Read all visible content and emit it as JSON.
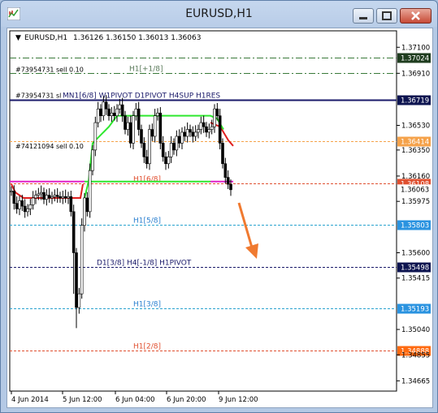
{
  "window": {
    "title": "EURUSD,H1"
  },
  "header": {
    "marker": "▼",
    "symbol": "EURUSD,H1",
    "quote": "1.36126 1.36150 1.36013 1.36063"
  },
  "chart_data": {
    "type": "candlestick",
    "ylim": [
      1.3459,
      1.3722
    ],
    "y_ticks": [
      "1.37100",
      "1.36910",
      "1.36530",
      "1.36350",
      "1.36160",
      "1.35975",
      "1.35600",
      "1.35415",
      "1.35040",
      "1.34855",
      "1.34665"
    ],
    "x_ticks": [
      "4 Jun 2014",
      "5 Jun 12:00",
      "6 Jun 04:00",
      "6 Jun 20:00",
      "9 Jun 12:00"
    ],
    "levels": [
      {
        "name": "H1[+1/8]",
        "price": 1.3691,
        "color": "#3a7a3a",
        "style": "dashdot",
        "label": "H1[+1/8]",
        "label_color": "#5a7a5a",
        "tag": ""
      },
      {
        "name": "orange-mid",
        "price": 1.36414,
        "color": "#f5a24a",
        "style": "dashed",
        "label": "",
        "tag": "1.36414",
        "tag_color": "#f5a24a"
      },
      {
        "name": "green-level",
        "price": 1.37024,
        "color": "#3a7a3a",
        "style": "dashdot",
        "label": "",
        "tag": "1.37024",
        "tag_color": "#1f3d1f"
      },
      {
        "name": "H1[6/8]",
        "price": 1.36108,
        "color": "#e05030",
        "style": "dashed",
        "label": "H1[6/8]",
        "label_color": "#e05030",
        "tag": "1.36108",
        "tag_color": "#e05030"
      },
      {
        "name": "H1[5/8]",
        "price": 1.35803,
        "color": "#2aa3cf",
        "style": "dashed",
        "label": "H1[5/8]",
        "label_color": "#2a7fcf",
        "tag": "1.35803",
        "tag_color": "#2a93e0"
      },
      {
        "name": "H1PIVOT",
        "price": 1.35498,
        "color": "#1a1a6a",
        "style": "dashed",
        "label": "D1[3/8] H4[-1/8] H1PIVOT",
        "label_color": "#1a1a6a",
        "tag": "1.35498",
        "tag_color": "#0d1450"
      },
      {
        "name": "H1[3/8]",
        "price": 1.35193,
        "color": "#2aa3cf",
        "style": "dashed",
        "label": "H1[3/8]",
        "label_color": "#2a7fcf",
        "tag": "1.35193",
        "tag_color": "#2a93e0"
      },
      {
        "name": "H1[2/8]",
        "price": 1.34888,
        "color": "#e05030",
        "style": "dashed",
        "label": "H1[2/8]",
        "label_color": "#e05030",
        "tag": "1.34888",
        "tag_color": "#ff6a10"
      },
      {
        "name": "MN1-res",
        "price": 1.36719,
        "color": "#1a1a6a",
        "style": "solid",
        "label": "MN1[6/8] W1PIVOT D1PIVOT H4SUP H1RES",
        "label_color": "#1a1a6a",
        "tag": "1.36719",
        "tag_color": "#0d1450"
      }
    ],
    "orders": [
      {
        "label": "#73954731 sell 0.10",
        "price": 1.3691
      },
      {
        "label": "#73954731 sl",
        "price": 1.36719
      },
      {
        "label": "#74121094 sell 0.10",
        "price": 1.3635
      }
    ],
    "current_price_tag": {
      "price": 1.36063,
      "text": "1.36063",
      "color": "#000000"
    },
    "closes": [
      1.3605,
      1.3596,
      1.3592,
      1.3598,
      1.3594,
      1.359,
      1.3592,
      1.3595,
      1.36,
      1.3602,
      1.3603,
      1.3604,
      1.3599,
      1.3602,
      1.36,
      1.3601,
      1.3602,
      1.3601,
      1.36,
      1.3601,
      1.36,
      1.3601,
      1.359,
      1.356,
      1.352,
      1.353,
      1.358,
      1.36,
      1.359,
      1.362,
      1.3635,
      1.3655,
      1.3665,
      1.366,
      1.367,
      1.3665,
      1.366,
      1.3662,
      1.366,
      1.3665,
      1.3668,
      1.366,
      1.365,
      1.3655,
      1.364,
      1.366,
      1.3665,
      1.365,
      1.364,
      1.363,
      1.3625,
      1.365,
      1.3645,
      1.366,
      1.3662,
      1.364,
      1.363,
      1.3625,
      1.363,
      1.364,
      1.3635,
      1.3645,
      1.364,
      1.3648,
      1.3645,
      1.365,
      1.3648,
      1.3645,
      1.3648,
      1.365,
      1.3655,
      1.3652,
      1.3648,
      1.365,
      1.3652,
      1.3665,
      1.366,
      1.364,
      1.3625,
      1.3615,
      1.361,
      1.3606
    ]
  }
}
